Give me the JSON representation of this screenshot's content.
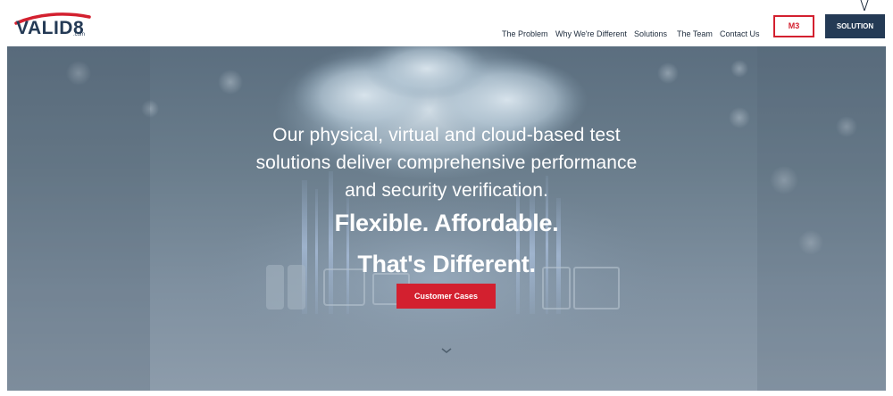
{
  "header": {
    "logo": {
      "text": "VALID8",
      "suffix": ".com"
    },
    "nav": [
      {
        "label": "The Problem"
      },
      {
        "label": "Why We're Different"
      },
      {
        "label": "Solutions"
      },
      {
        "label": "The Team"
      },
      {
        "label": "Contact Us"
      }
    ],
    "m3_button": "M3",
    "solution_button": "SOLUTION"
  },
  "hero": {
    "lines": [
      "Our physical, virtual and cloud-based test",
      "solutions deliver comprehensive performance",
      "and security verification."
    ],
    "tagline_1": "Flexible. Affordable.",
    "tagline_2": "That's Different.",
    "cta_label": "Customer Cases"
  },
  "colors": {
    "brand_navy": "#243a55",
    "brand_red": "#d3202f"
  },
  "icons": {
    "scroll_down": "chevron-down-icon"
  }
}
